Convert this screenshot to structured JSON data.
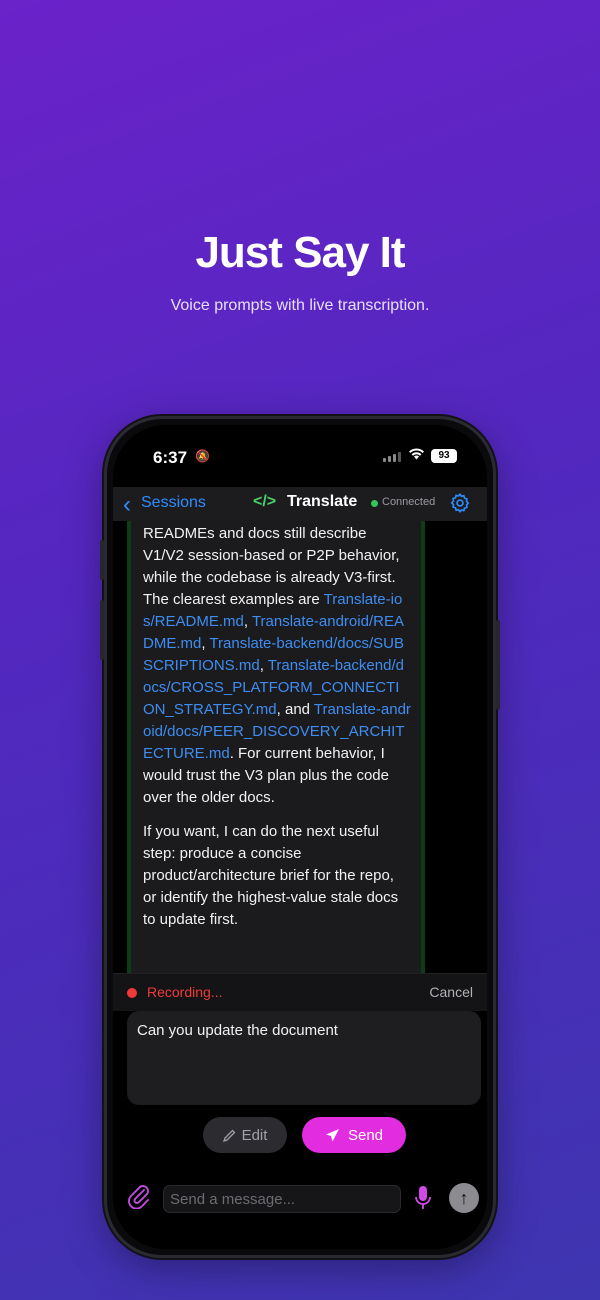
{
  "hero": {
    "title": "Just Say It",
    "subtitle": "Voice prompts with live transcription."
  },
  "status_bar": {
    "time": "6:37",
    "battery": "93"
  },
  "nav": {
    "back_label": "Sessions",
    "back_icon": "chevron-left-icon",
    "title_icon": "code-brackets-icon",
    "title": "Translate",
    "connection_status": "Connected",
    "settings_icon": "gear-icon"
  },
  "message": {
    "p1_text_a": "READMEs and docs still describe V1/V2 session-based or P2P behavior, while the codebase is already V3-first. The clearest examples are ",
    "link1": "Translate-ios/README.md",
    "sep1": ", ",
    "link2": "Translate-android/README.md",
    "sep2": ", ",
    "link3": "Translate-backend/docs/SUBSCRIPTIONS.md",
    "sep3": ", ",
    "link4": "Translate-backend/docs/CROSS_PLATFORM_CONNECTION_STRATEGY.md",
    "sep4": ", and ",
    "link5": "Translate-android/docs/PEER_DISCOVERY_ARCHITECTURE.md",
    "p1_text_b": ". For current behavior, I would trust the V3 plan plus the code over the older docs.",
    "p2": "If you want, I can do the next useful step: produce a concise product/architecture brief for the repo, or identify the highest-value stale docs to update first."
  },
  "recording": {
    "label": "Recording...",
    "cancel": "Cancel"
  },
  "transcript": "Can you update the document",
  "actions": {
    "edit_label": "Edit",
    "send_label": "Send"
  },
  "composer": {
    "placeholder": "Send a message..."
  },
  "colors": {
    "accent_blue": "#2f8cff",
    "send_magenta": "#e22ce0",
    "recording_red": "#f03a3a",
    "connected_green": "#33c759"
  }
}
